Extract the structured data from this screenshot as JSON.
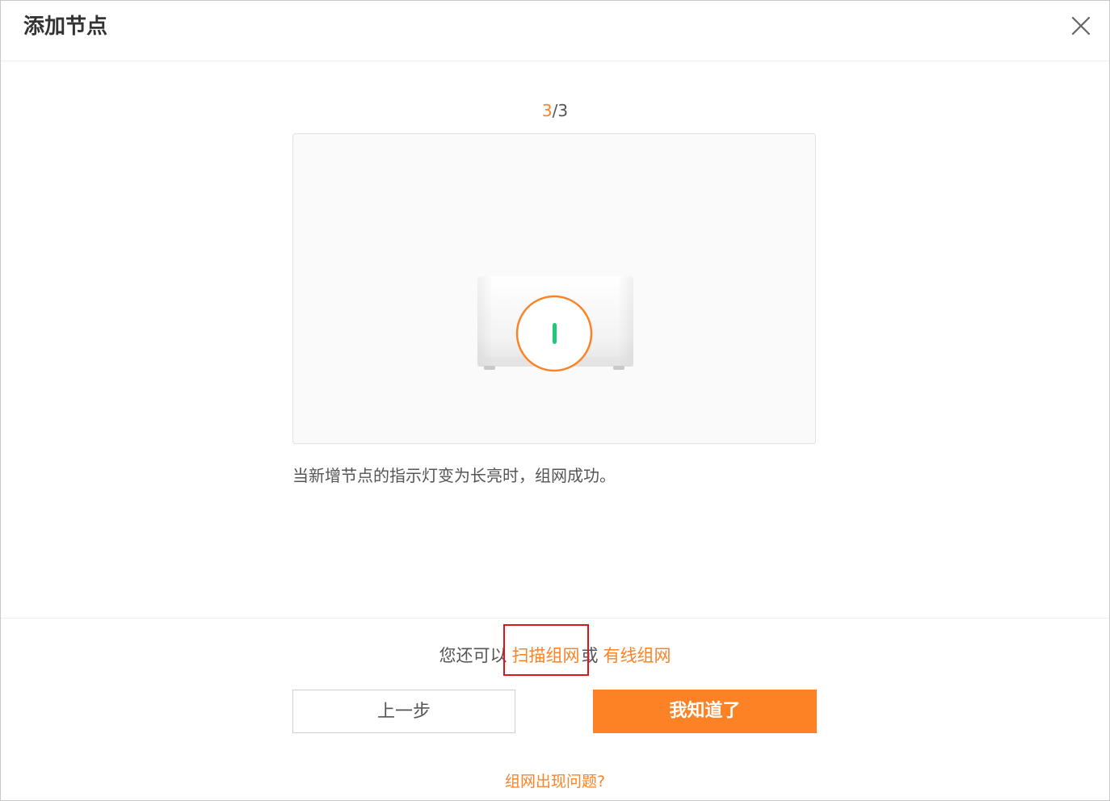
{
  "dialog": {
    "title": "添加节点",
    "close_icon": "close-icon"
  },
  "step": {
    "current": "3",
    "separator": "/",
    "total": "3"
  },
  "illustration": {
    "device_icon": "node-device-icon",
    "indicator_color": "#22c77a",
    "highlight_color": "#fb8327"
  },
  "instruction": "当新增节点的指示灯变为长亮时，组网成功。",
  "alternatives": {
    "prefix": "您还可以",
    "scan_link": "扫描组网",
    "or": "或",
    "wired_link": "有线组网"
  },
  "buttons": {
    "prev": "上一步",
    "ok": "我知道了"
  },
  "help_link": "组网出现问题?",
  "colors": {
    "accent": "#fb8327",
    "highlight_box": "#e0141e"
  }
}
